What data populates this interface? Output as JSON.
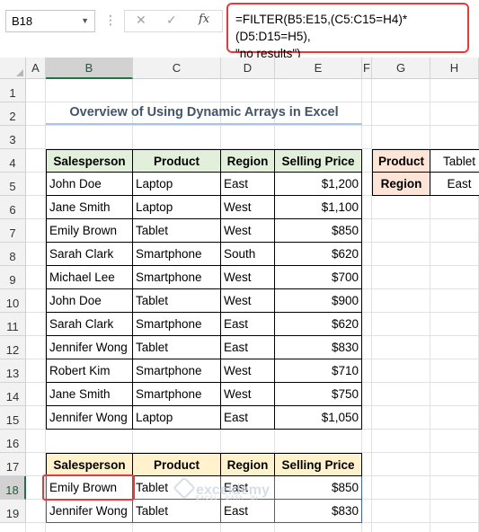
{
  "formula_bar": {
    "name_box": "B18",
    "cancel_icon": "✕",
    "enter_icon": "✓",
    "fx_label": "fx",
    "formula": "=FILTER(B5:E15,(C5:C15=H4)*(D5:D15=H5),\n\"no results\")"
  },
  "columns": [
    "A",
    "B",
    "C",
    "D",
    "E",
    "F",
    "G",
    "H"
  ],
  "rows": [
    "1",
    "2",
    "3",
    "4",
    "5",
    "6",
    "7",
    "8",
    "9",
    "10",
    "11",
    "12",
    "13",
    "14",
    "15",
    "16",
    "17",
    "18",
    "19"
  ],
  "selected": {
    "column": "B",
    "row": "18"
  },
  "title": "Overview of Using Dynamic Arrays in Excel",
  "main_table": {
    "headers": [
      "Salesperson",
      "Product",
      "Region",
      "Selling Price"
    ],
    "rows": [
      [
        "John Doe",
        "Laptop",
        "East",
        "$1,200"
      ],
      [
        "Jane Smith",
        "Laptop",
        "West",
        "$1,100"
      ],
      [
        "Emily Brown",
        "Tablet",
        "West",
        "$850"
      ],
      [
        "Sarah Clark",
        "Smartphone",
        "South",
        "$620"
      ],
      [
        "Michael Lee",
        "Smartphone",
        "West",
        "$700"
      ],
      [
        "John Doe",
        "Tablet",
        "West",
        "$900"
      ],
      [
        "Sarah Clark",
        "Smartphone",
        "East",
        "$620"
      ],
      [
        "Jennifer Wong",
        "Tablet",
        "East",
        "$830"
      ],
      [
        "Robert Kim",
        "Smartphone",
        "West",
        "$710"
      ],
      [
        "Jane Smith",
        "Smartphone",
        "West",
        "$750"
      ],
      [
        "Jennifer Wong",
        "Laptop",
        "East",
        "$1,050"
      ]
    ]
  },
  "criteria": {
    "product_label": "Product",
    "product_value": "Tablet",
    "region_label": "Region",
    "region_value": "East"
  },
  "result_table": {
    "headers": [
      "Salesperson",
      "Product",
      "Region",
      "Selling Price"
    ],
    "rows": [
      [
        "Emily Brown",
        "Tablet",
        "East",
        "$850"
      ],
      [
        "Jennifer Wong",
        "Tablet",
        "East",
        "$830"
      ]
    ]
  },
  "watermark": {
    "name": "exceldemy",
    "tagline": "EXCEL · DATA · BI"
  },
  "colors": {
    "header_green": "#e2efda",
    "criteria_peach": "#fce4d6",
    "result_yellow": "#fff2cc",
    "highlight_red": "#e23b3b",
    "excel_green": "#217346"
  }
}
